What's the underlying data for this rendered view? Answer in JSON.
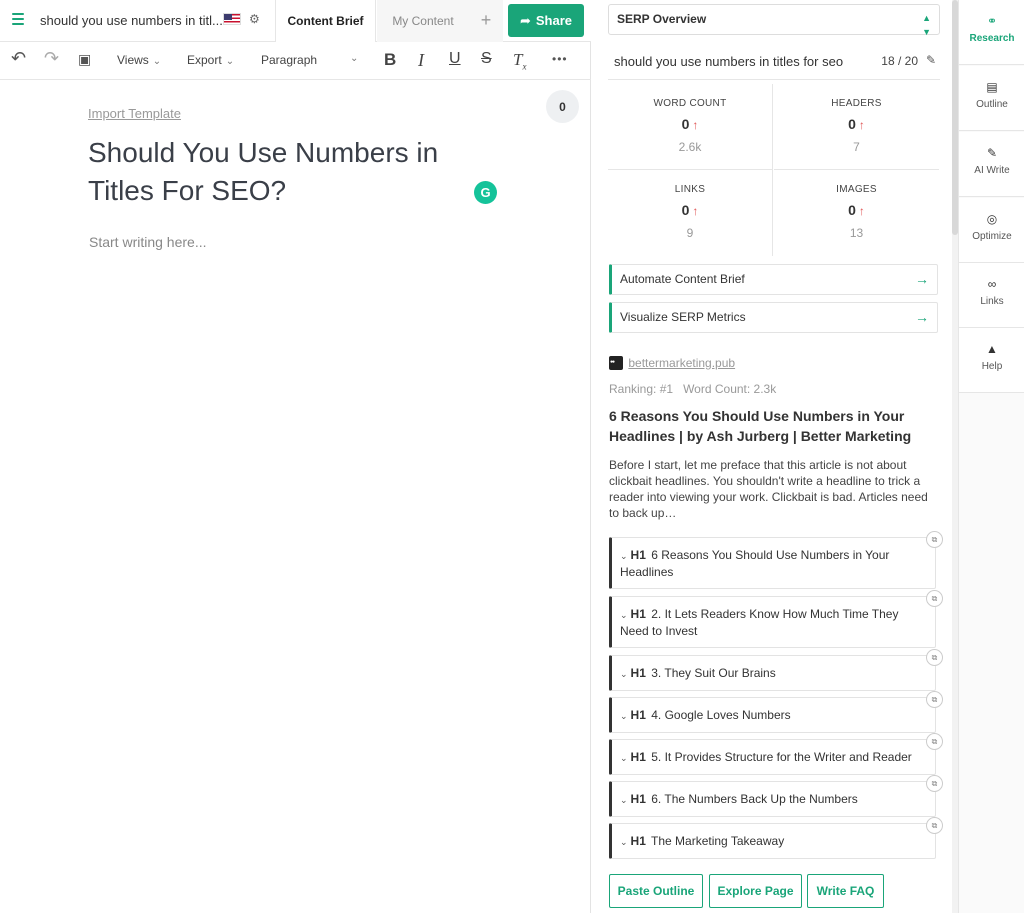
{
  "editor": {
    "doc_title": "should you use numbers in titl...",
    "tabs": {
      "brief": "Content Brief",
      "mine": "My Content"
    },
    "share_label": "Share",
    "toolbar": {
      "views": "Views",
      "export": "Export",
      "paragraph": "Paragraph",
      "more": "•••"
    },
    "import_template": "Import Template",
    "heading": "Should You Use Numbers in Titles For SEO?",
    "word_count_badge": "0",
    "placeholder": "Start writing here..."
  },
  "panel": {
    "select_label": "SERP Overview",
    "keyword": "should you use numbers in titles for seo",
    "keyword_count": "18 / 20",
    "metrics": [
      {
        "label": "WORD COUNT",
        "value": "0",
        "target": "2.6k"
      },
      {
        "label": "HEADERS",
        "value": "0",
        "target": "7"
      },
      {
        "label": "LINKS",
        "value": "0",
        "target": "9"
      },
      {
        "label": "IMAGES",
        "value": "0",
        "target": "13"
      }
    ],
    "actions": [
      "Automate Content Brief",
      "Visualize SERP Metrics"
    ],
    "result": {
      "source": "bettermarketing.pub",
      "ranking": "Ranking: #1",
      "word_count": "Word Count: 2.3k",
      "title": "6 Reasons You Should Use Numbers in Your Headlines | by Ash Jurberg | Better Marketing",
      "description": "Before I start, let me preface that this article is not about clickbait headlines. You shouldn't write a headline to trick a reader into viewing your work. Clickbait is bad. Articles need to back up…",
      "headings": [
        {
          "tag": "H1",
          "text": "6 Reasons You Should Use Numbers in Your Headlines"
        },
        {
          "tag": "H1",
          "text": "2. It Lets Readers Know How Much Time They Need to Invest"
        },
        {
          "tag": "H1",
          "text": "3. They Suit Our Brains"
        },
        {
          "tag": "H1",
          "text": "4. Google Loves Numbers"
        },
        {
          "tag": "H1",
          "text": "5. It Provides Structure for the Writer and Reader"
        },
        {
          "tag": "H1",
          "text": "6. The Numbers Back Up the Numbers"
        },
        {
          "tag": "H1",
          "text": "The Marketing Takeaway"
        }
      ]
    },
    "buttons": {
      "paste_outline": "Paste Outline",
      "explore_page": "Explore Page",
      "write_faq": "Write FAQ"
    }
  },
  "sidenav": [
    {
      "label": "Research",
      "icon": "binoculars-icon"
    },
    {
      "label": "Outline",
      "icon": "document-icon"
    },
    {
      "label": "AI Write",
      "icon": "magic-wand-icon"
    },
    {
      "label": "Optimize",
      "icon": "target-icon"
    },
    {
      "label": "Links",
      "icon": "link-icon"
    },
    {
      "label": "Help",
      "icon": "graduation-cap-icon"
    }
  ],
  "colors": {
    "accent": "#1aa579",
    "arrow_up": "#e05555"
  }
}
